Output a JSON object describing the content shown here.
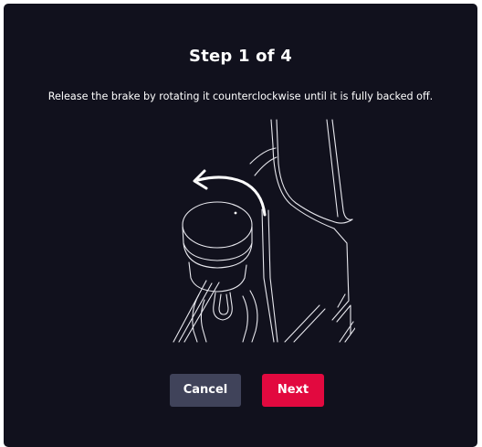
{
  "dialog": {
    "title": "Step 1 of 4",
    "instruction": "Release the brake by rotating it counterclockwise until it is fully backed off.",
    "illustration_icon": "brake-knob-rotate-counterclockwise-illustration",
    "buttons": {
      "cancel_label": "Cancel",
      "next_label": "Next"
    }
  },
  "colors": {
    "dialog_background": "#11111d",
    "text": "#ffffff",
    "cancel_button": "#40435a",
    "next_button": "#e2093f"
  }
}
